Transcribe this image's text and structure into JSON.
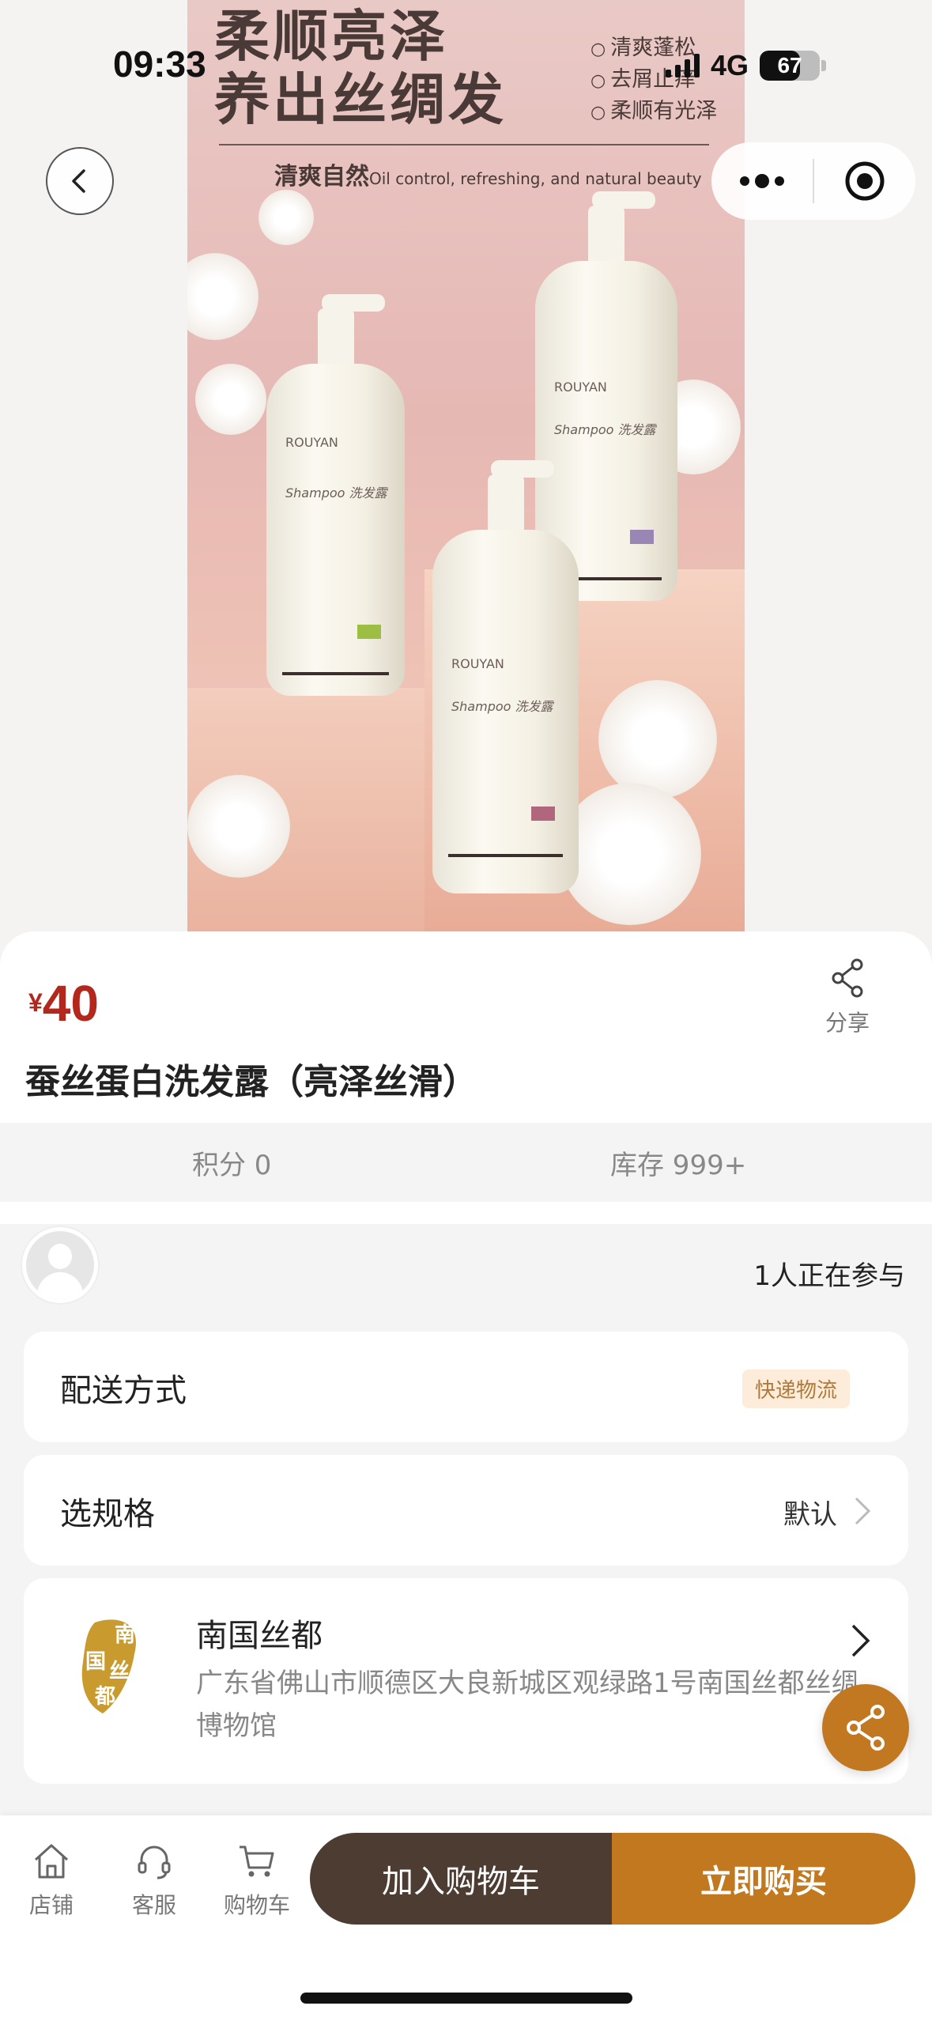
{
  "status_bar": {
    "time": "09:33",
    "network": "4G",
    "battery": "67",
    "battery_level": 0.67
  },
  "product_image": {
    "headline_line1": "柔顺亮泽",
    "headline_line2": "养出丝绸发",
    "bullets": [
      "清爽蓬松",
      "去屑止痒",
      "柔顺有光泽"
    ],
    "sub_cn": "清爽自然",
    "sub_en": "Oil control, refreshing, and natural beauty",
    "bottle_brand": "ROUYAN",
    "bottle_label": "Shampoo 洗发露"
  },
  "product": {
    "currency": "¥",
    "price": "40",
    "title": "蚕丝蛋白洗发露（亮泽丝滑）",
    "share_label": "分享",
    "points": "积分 0",
    "stock": "库存 999+"
  },
  "participants": {
    "text": "1人正在参与"
  },
  "delivery": {
    "label": "配送方式",
    "badge": "快递物流"
  },
  "spec": {
    "label": "选规格",
    "value": "默认"
  },
  "shop": {
    "logo_text": "南国丝都",
    "name": "南国丝都",
    "address": "广东省佛山市顺德区大良新城区观绿路1号南国丝都丝绸博物馆"
  },
  "bottom_nav": {
    "shop": "店铺",
    "service": "客服",
    "cart": "购物车",
    "add_to_cart": "加入购物车",
    "buy_now": "立即购买"
  },
  "colors": {
    "price": "#b4271c",
    "accent": "#c2781e",
    "dark_button": "#4d3c32"
  },
  "icons": [
    "back-icon",
    "more-icon",
    "target-icon",
    "share-icon",
    "store-icon",
    "headset-icon",
    "cart-icon",
    "chevron-right-icon"
  ]
}
